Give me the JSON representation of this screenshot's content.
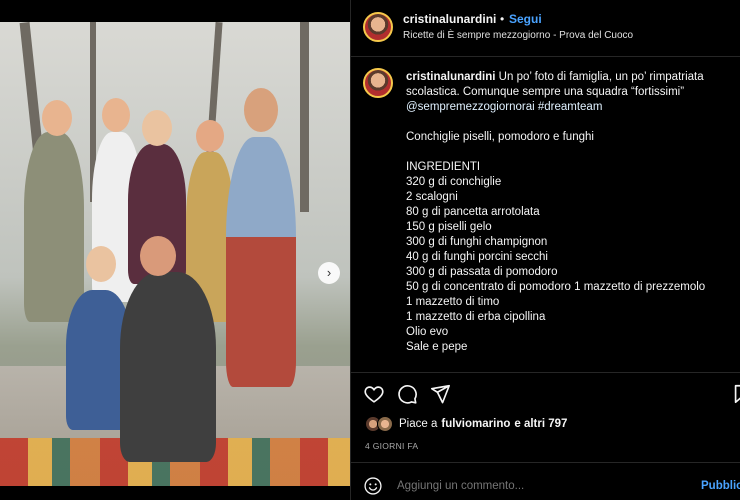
{
  "post": {
    "username": "cristinalunardini",
    "follow_label": "Segui",
    "location": "Ricette di È sempre mezzogiorno - Prova del Cuoco",
    "caption_intro": "Un po’ foto di famiglia, un po’ rimpatriata scolastica. Comunque sempre una squadra “fortissimi”",
    "caption_tags": "@sempremezzogiornorai #dreamteam",
    "recipe_title": "Conchiglie piselli, pomodoro e funghi",
    "ingredients_heading": "INGREDIENTI",
    "ingredients": [
      "320 g di conchiglie",
      "2 scalogni",
      "80 g di pancetta arrotolata",
      "150 g piselli gelo",
      "300 g di funghi champignon",
      "40 g di funghi porcini secchi",
      "300 g di passata di pomodoro",
      "50 g di concentrato di pomodoro 1 mazzetto di prezzemolo",
      "1 mazzetto di timo",
      "1 mazzetto di erba cipollina",
      "Olio evo",
      "Sale e pepe"
    ],
    "likes_prefix": "Piace a",
    "likes_user": "fulviomarino",
    "likes_rest": "e altri 797",
    "date": "4 GIORNI FA",
    "comment_placeholder": "Aggiungi un commento...",
    "publish_label": "Pubblica"
  },
  "carousel": {
    "total": 4,
    "active": 1
  },
  "icons": {
    "like": "heart-icon",
    "comment": "comment-icon",
    "share": "send-icon",
    "save": "bookmark-icon",
    "emoji": "emoji-icon",
    "next": "chevron-right-icon"
  },
  "colors": {
    "link": "#4aa3ff",
    "background": "#000000",
    "muted": "#a8a8a8"
  }
}
